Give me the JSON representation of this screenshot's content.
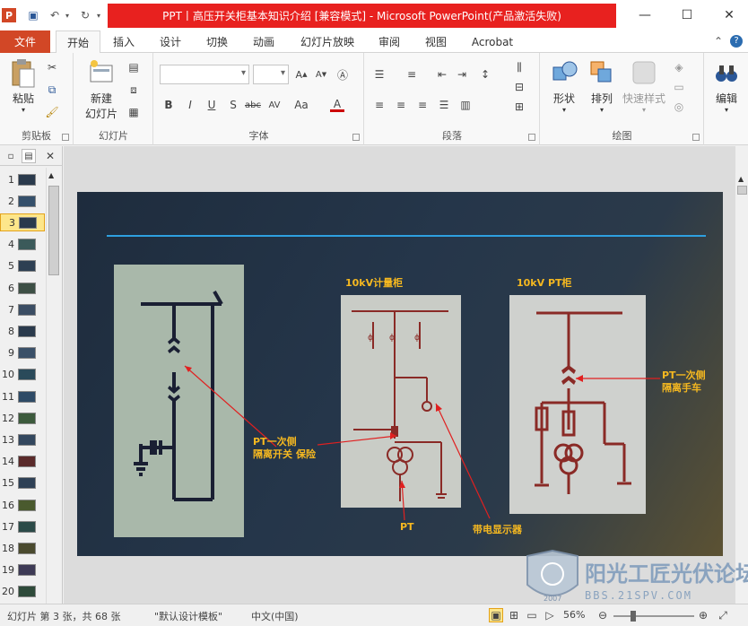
{
  "window": {
    "title": "PPT丨高压开关柜基本知识介绍 [兼容模式] - Microsoft PowerPoint(产品激活失败)",
    "minimize_icon": "minimize-icon",
    "restore_icon": "restore-icon",
    "close_icon": "close-icon"
  },
  "tabs": [
    "文件",
    "开始",
    "插入",
    "设计",
    "切换",
    "动画",
    "幻灯片放映",
    "审阅",
    "视图",
    "Acrobat"
  ],
  "ribbon": {
    "clipboard": {
      "paste": "粘贴",
      "label": "剪贴板"
    },
    "slides": {
      "new_slide_1": "新建",
      "new_slide_2": "幻灯片",
      "label": "幻灯片"
    },
    "font": {
      "label": "字体"
    },
    "paragraph": {
      "label": "段落"
    },
    "drawing": {
      "shape": "形状",
      "arrange": "排列",
      "quick_styles": "快速样式",
      "label": "绘图"
    },
    "editing": {
      "edit": "编辑"
    }
  },
  "thumbnails": [
    "1",
    "2",
    "3",
    "4",
    "5",
    "6",
    "7",
    "8",
    "9",
    "10",
    "11",
    "12",
    "13",
    "14",
    "15",
    "16",
    "17",
    "18",
    "19",
    "20"
  ],
  "selected_slide": 3,
  "slide": {
    "label_metering": "10kV计量柜",
    "label_pt_cabinet": "10kV PT柜",
    "label_isolation": "PT一次侧\n隔离开关",
    "label_fuse": "保险",
    "label_pt_handcart": "PT一次侧\n隔离手车",
    "label_pt": "PT",
    "label_live_display": "带电显示器"
  },
  "status": {
    "slide_info": "幻灯片 第 3 张，共 68 张",
    "theme": "\"默认设计模板\"",
    "language": "中文(中国)",
    "zoom": "56%"
  },
  "watermark": {
    "brand": "阳光工匠光伏论坛",
    "url": "BBS.21SPV.COM",
    "year": "2007"
  }
}
